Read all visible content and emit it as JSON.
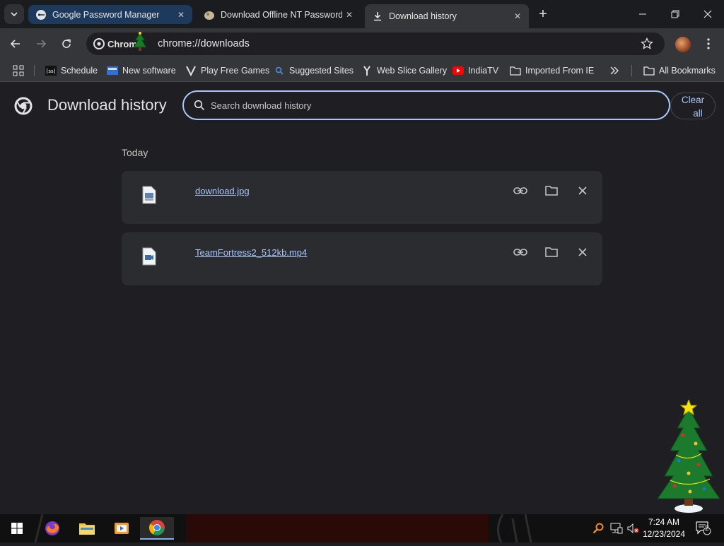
{
  "tabs": [
    {
      "title": "Google Password Manager"
    },
    {
      "title": "Download Offline NT Password"
    },
    {
      "title": "Download history"
    }
  ],
  "toolbar": {
    "chip_label": "Chrome",
    "url": "chrome://downloads"
  },
  "bookmarks": [
    {
      "label": "Schedule"
    },
    {
      "label": "New software"
    },
    {
      "label": "Play Free Games"
    },
    {
      "label": "Suggested Sites"
    },
    {
      "label": "Web Slice Gallery"
    },
    {
      "label": "IndiaTV"
    },
    {
      "label": "Imported From IE"
    }
  ],
  "all_bookmarks_label": "All Bookmarks",
  "page": {
    "title": "Download history",
    "search_placeholder": "Search download history",
    "clear_all_line1": "Clear",
    "clear_all_line2": "all",
    "section_label": "Today",
    "downloads": [
      {
        "file_name": "download.jpg"
      },
      {
        "file_name": "TeamFortress2_512kb.mp4"
      }
    ]
  },
  "taskbar": {
    "time": "7:24 AM",
    "date": "12/23/2024",
    "notification_count": "2"
  },
  "colors": {
    "accent": "#a8c7fa",
    "page_bg": "#1f1f23",
    "card_bg": "#2b2c30"
  }
}
